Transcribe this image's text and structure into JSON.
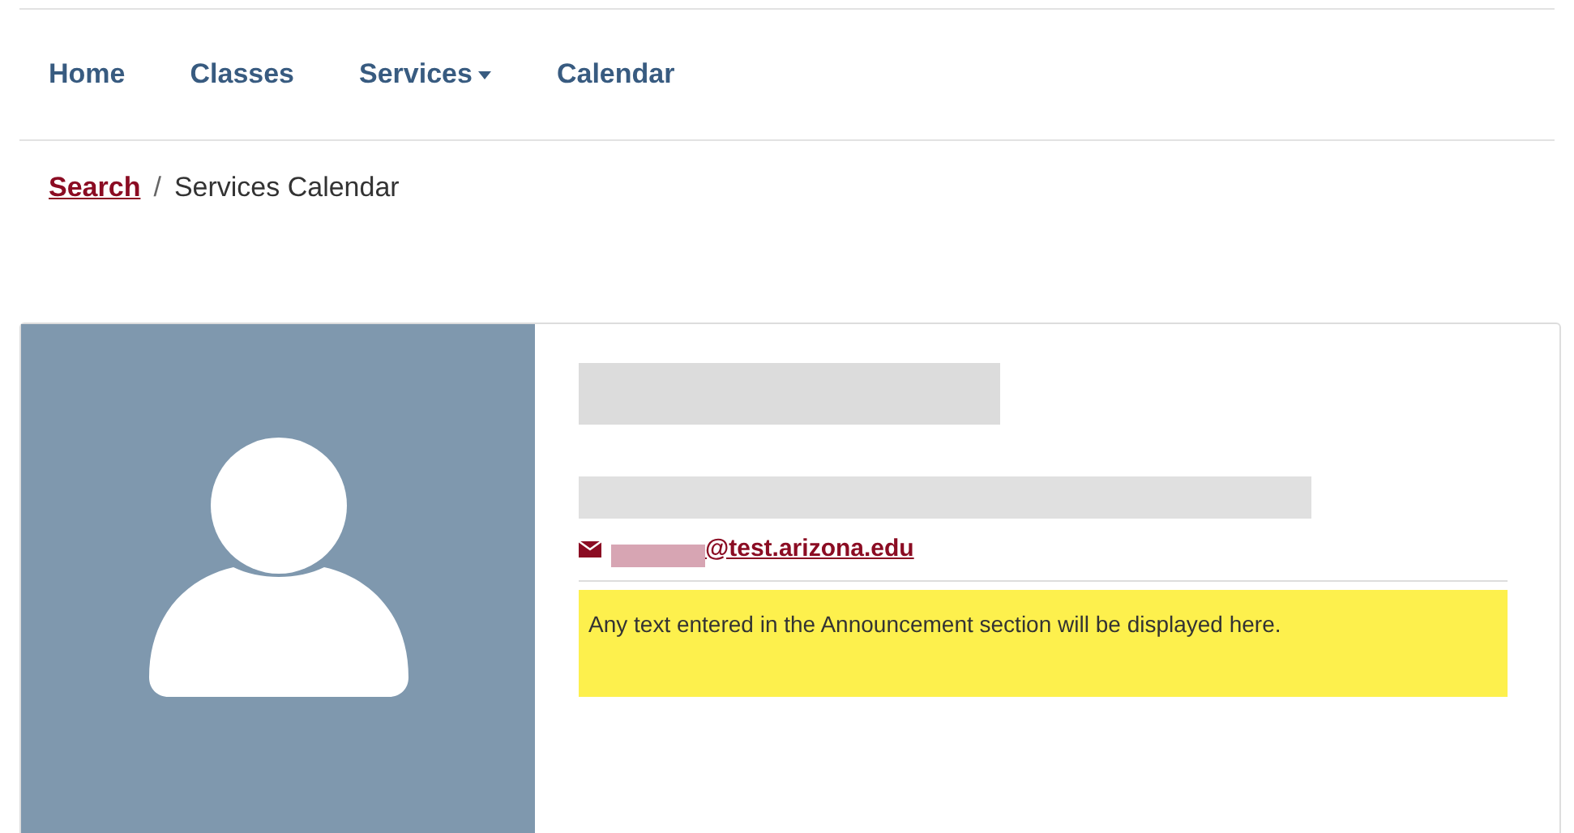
{
  "nav": [
    {
      "label": "Home",
      "has_menu": false
    },
    {
      "label": "Classes",
      "has_menu": false
    },
    {
      "label": "Services",
      "has_menu": true
    },
    {
      "label": "Calendar",
      "has_menu": false
    }
  ],
  "breadcrumb": {
    "link": "Search",
    "separator": "/",
    "current": "Services Calendar"
  },
  "profile": {
    "email_domain": "@test.arizona.edu",
    "announcement": "Any text entered in the Announcement section will be displayed here."
  }
}
